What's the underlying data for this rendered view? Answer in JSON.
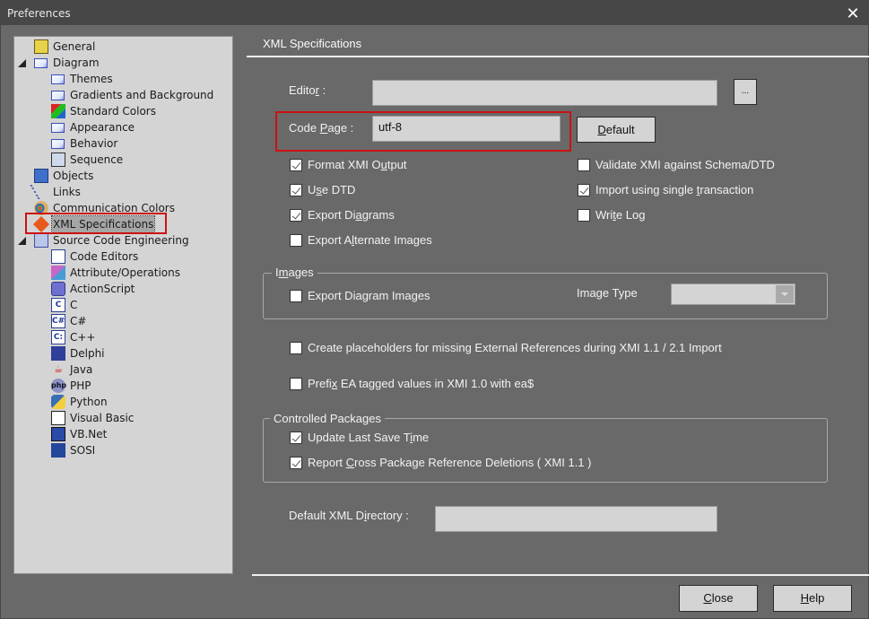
{
  "window": {
    "title": "Preferences",
    "close_icon": "close-icon"
  },
  "tree": {
    "items": [
      {
        "label": "General",
        "icon": "general-settings-icon",
        "level": 1,
        "expanded": null
      },
      {
        "label": "Diagram",
        "icon": "diagram-page-icon",
        "level": 1,
        "expanded": true
      },
      {
        "label": "Themes",
        "icon": "diagram-page-icon",
        "level": 2
      },
      {
        "label": "Gradients and Background",
        "icon": "diagram-page-icon",
        "level": 2
      },
      {
        "label": "Standard Colors",
        "icon": "standard-colors-icon",
        "level": 2
      },
      {
        "label": "Appearance",
        "icon": "diagram-page-icon",
        "level": 2
      },
      {
        "label": "Behavior",
        "icon": "diagram-page-icon",
        "level": 2
      },
      {
        "label": "Sequence",
        "icon": "sequence-icon",
        "level": 2
      },
      {
        "label": "Objects",
        "icon": "objects-icon",
        "level": 1
      },
      {
        "label": "Links",
        "icon": "links-icon",
        "level": 1
      },
      {
        "label": "Communication Colors",
        "icon": "palette-icon",
        "level": 1
      },
      {
        "label": "XML Specifications",
        "icon": "xml-icon",
        "level": 1,
        "selected": true
      },
      {
        "label": "Source Code Engineering",
        "icon": "source-code-icon",
        "level": 1,
        "expanded": true
      },
      {
        "label": "Code Editors",
        "icon": "code-editor-icon",
        "level": 2
      },
      {
        "label": "Attribute/Operations",
        "icon": "attribute-operations-icon",
        "level": 2
      },
      {
        "label": "ActionScript",
        "icon": "actionscript-icon",
        "level": 2
      },
      {
        "label": "C",
        "icon": "c-language-icon",
        "level": 2,
        "glyph": "C"
      },
      {
        "label": "C#",
        "icon": "csharp-language-icon",
        "level": 2,
        "glyph": "C#"
      },
      {
        "label": "C++",
        "icon": "cpp-language-icon",
        "level": 2,
        "glyph": "C:"
      },
      {
        "label": "Delphi",
        "icon": "delphi-icon",
        "level": 2
      },
      {
        "label": "Java",
        "icon": "java-icon",
        "level": 2
      },
      {
        "label": "PHP",
        "icon": "php-icon",
        "level": 2,
        "glyph": "php"
      },
      {
        "label": "Python",
        "icon": "python-icon",
        "level": 2
      },
      {
        "label": "Visual Basic",
        "icon": "visual-basic-icon",
        "level": 2
      },
      {
        "label": "VB.Net",
        "icon": "vbnet-icon",
        "level": 2
      },
      {
        "label": "SOSI",
        "icon": "sosi-icon",
        "level": 2
      }
    ]
  },
  "panel": {
    "title": "XML Specifications",
    "editor": {
      "label_pre": "Edito",
      "label_u": "r",
      "label_post": " :",
      "value": "",
      "browse_label": "..."
    },
    "code_page": {
      "label_pre": "Code ",
      "label_u": "P",
      "label_post": "age :",
      "value": "utf-8",
      "default_pre": "",
      "default_u": "D",
      "default_post": "efault"
    },
    "checkboxes_left": [
      {
        "pre": "Format XMI O",
        "u": "u",
        "post": "tput",
        "checked": true
      },
      {
        "pre": "U",
        "u": "s",
        "post": "e DTD",
        "checked": true
      },
      {
        "pre": "Export Di",
        "u": "a",
        "post": "grams",
        "checked": true
      },
      {
        "pre": "Export A",
        "u": "l",
        "post": "ternate Images",
        "checked": false
      }
    ],
    "checkboxes_right": [
      {
        "pre": "Validate XMI against Schema/DTD",
        "u": "",
        "post": "",
        "checked": false
      },
      {
        "pre": "Import using single ",
        "u": "t",
        "post": "ransaction",
        "checked": true
      },
      {
        "pre": "Wri",
        "u": "t",
        "post": "e Log",
        "checked": false
      }
    ],
    "images_group": {
      "label_pre": "I",
      "label_u": "m",
      "label_post": "ages",
      "export_diagram_images": {
        "label": "Export Diagram Images",
        "checked": false
      },
      "image_type_label": "Image Type",
      "image_type_value": ""
    },
    "placeholders": {
      "label": "Create placeholders for missing External References during XMI 1.1 / 2.1 Import",
      "checked": false
    },
    "prefix": {
      "pre": "Prefi",
      "u": "x",
      "post": " EA tagged values in XMI 1.0 with ea$",
      "checked": false
    },
    "controlled_packages": {
      "label": "Controlled Packages",
      "update_last_save": {
        "pre": "Update Last Save T",
        "u": "i",
        "post": "me",
        "checked": true
      },
      "report_cross": {
        "pre": "Report ",
        "u": "C",
        "post": "ross Package Reference Deletions ( XMI 1.1 )",
        "checked": true
      }
    },
    "default_dir": {
      "label_pre": "Default XML D",
      "label_u": "i",
      "label_post": "rectory :",
      "value": ""
    }
  },
  "footer": {
    "close": {
      "u": "C",
      "post": "lose"
    },
    "help": {
      "u": "H",
      "post": "elp"
    }
  },
  "colors": {
    "background": "#696969",
    "titlebar": "#474747",
    "field": "#d4d4d4",
    "highlight": "#cc1111"
  }
}
